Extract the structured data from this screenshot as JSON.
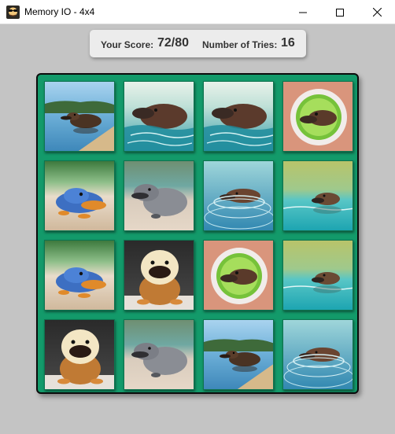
{
  "window": {
    "title": "Memory IO - 4x4",
    "icon": "game-app-icon",
    "controls": [
      "minimize-icon",
      "maximize-icon",
      "close-icon"
    ]
  },
  "score": {
    "label": "Your Score:",
    "value": "72/80"
  },
  "tries": {
    "label": "Number of Tries:",
    "value": "16"
  },
  "grid": {
    "rows": 4,
    "cols": 4,
    "cards": [
      [
        "platypus-lake-dock",
        "platypus-swimming-close",
        "platypus-swimming-close",
        "platypus-plate-bowl"
      ],
      [
        "platypus-blue-toy",
        "platypus-plush-grey",
        "platypus-swimming-ripples",
        "platypus-lake-blurred"
      ],
      [
        "platypus-blue-toy",
        "platypus-cartoon-cream",
        "platypus-plate-bowl",
        "platypus-lake-blurred"
      ],
      [
        "platypus-cartoon-cream",
        "platypus-plush-grey",
        "platypus-lake-dock",
        "platypus-swimming-ripples"
      ]
    ]
  },
  "colors": {
    "board": "#139a6a",
    "background": "#c4c4c4",
    "scorebar": "#ececec"
  }
}
